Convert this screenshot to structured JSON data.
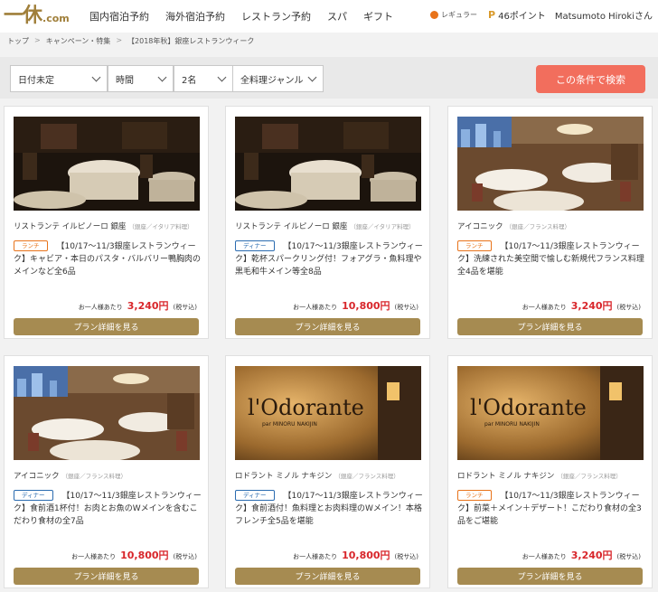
{
  "header": {
    "logo_mark": "一休",
    "logo_suffix": ".com",
    "nav": [
      "国内宿泊予約",
      "海外宿泊予約",
      "レストラン予約",
      "スパ",
      "ギフト"
    ],
    "rank": "レギュラー",
    "points_icon": "P",
    "points": "46ポイント",
    "user": "Matsumoto Hirokiさん"
  },
  "breadcrumb": [
    "トップ",
    "キャンペーン・特集",
    "【2018年秋】銀座レストランウィーク"
  ],
  "search": {
    "date": "日付未定",
    "time": "時間",
    "people": "2名",
    "genre": "全料理ジャンル",
    "button": "この条件で検索"
  },
  "colors": {
    "brand": "#a07f3a",
    "search_button": "#f26e5d",
    "detail_button": "#a68b51",
    "price": "#d8262b",
    "lunch_badge": "#e8731a",
    "dinner_badge": "#2b6cb0"
  },
  "cards": [
    {
      "name": "リストランテ イルピノーロ 銀座",
      "genre": "（銀座／イタリア料理）",
      "badge": "ランチ",
      "badge_type": "lunch",
      "plan": "【10/17～11/3銀座レストランウィーク】キャビア・本日のパスタ・バルバリー鴨胸肉のメインなど全6品",
      "price_label": "お一人様あたり",
      "price": "3,240円",
      "tax": "(税サ込)",
      "button": "プラン詳細を見る",
      "photo": "dark-dining-room"
    },
    {
      "name": "リストランテ イルピノーロ 銀座",
      "genre": "（銀座／イタリア料理）",
      "badge": "ディナー",
      "badge_type": "dinner",
      "plan": "【10/17～11/3銀座レストランウィーク】乾杯スパークリング付！フォアグラ・魚料理や黒毛和牛メイン等全8品",
      "price_label": "お一人様あたり",
      "price": "10,800円",
      "tax": "(税サ込)",
      "button": "プラン詳細を見る",
      "photo": "dark-dining-room"
    },
    {
      "name": "アイコニック",
      "genre": "（銀座／フランス料理）",
      "badge": "ランチ",
      "badge_type": "lunch",
      "plan": "【10/17～11/3銀座レストランウィーク】洗練された美空間で愉しむ新規代フランス料理全4品を堪能",
      "price_label": "お一人様あたり",
      "price": "3,240円",
      "tax": "(税サ込)",
      "button": "プラン詳細を見る",
      "photo": "bright-dining-room"
    },
    {
      "name": "アイコニック",
      "genre": "（銀座／フランス料理）",
      "badge": "ディナー",
      "badge_type": "dinner",
      "plan": "【10/17～11/3銀座レストランウィーク】食前酒1杯付！お肉とお魚のWメインを含むこだわり食材の全7品",
      "price_label": "お一人様あたり",
      "price": "10,800円",
      "tax": "(税サ込)",
      "button": "プラン詳細を見る",
      "photo": "bright-dining-room"
    },
    {
      "name": "ロドラント ミノル ナキジン",
      "genre": "（銀座／フランス料理）",
      "badge": "ディナー",
      "badge_type": "dinner",
      "plan": "【10/17～11/3銀座レストランウィーク】食前酒付！魚料理とお肉料理のWメイン！本格フレンチ全5品を堪能",
      "price_label": "お一人様あたり",
      "price": "10,800円",
      "tax": "(税サ込)",
      "button": "プラン詳細を見る",
      "photo": "lodorante-sign",
      "sign_text": "l'Odorante",
      "sign_sub": "par MINORU NAKIJIN"
    },
    {
      "name": "ロドラント ミノル ナキジン",
      "genre": "（銀座／フランス料理）",
      "badge": "ランチ",
      "badge_type": "lunch",
      "plan": "【10/17～11/3銀座レストランウィーク】前菜＋メイン＋デザート！こだわり食材の全3品をご堪能",
      "price_label": "お一人様あたり",
      "price": "3,240円",
      "tax": "(税サ込)",
      "button": "プラン詳細を見る",
      "photo": "lodorante-sign",
      "sign_text": "l'Odorante",
      "sign_sub": "par MINORU NAKIJIN"
    }
  ]
}
